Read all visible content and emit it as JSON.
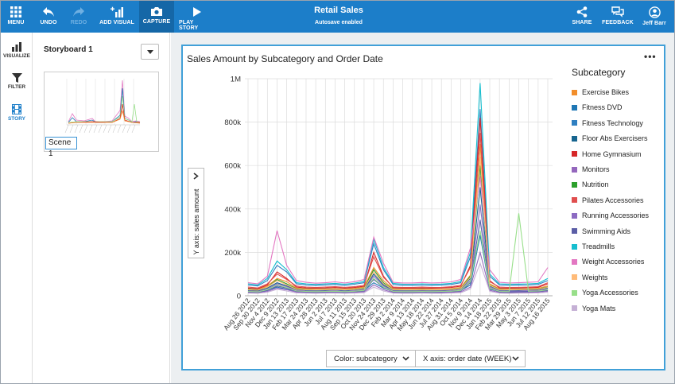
{
  "toolbar": {
    "menu": "MENU",
    "undo": "UNDO",
    "redo": "REDO",
    "add_visual": "ADD VISUAL",
    "capture": "CAPTURE",
    "play_story": "PLAY STORY",
    "title": "Retail Sales",
    "subtitle": "Autosave enabled",
    "share": "SHARE",
    "feedback": "FEEDBACK",
    "user": "Jeff Barr"
  },
  "rail": {
    "visualize": "VISUALIZE",
    "filter": "FILTER",
    "story": "STORY"
  },
  "storyboard": {
    "title": "Storyboard 1",
    "scene": "Scene 1"
  },
  "colors": {
    "topbar": "#1c7ec9",
    "accent": "#41a0d8"
  },
  "visual": {
    "title": "Sales Amount by Subcategory and Order Date",
    "more": "•••",
    "y_axis_field": "Y axis: sales amount",
    "color_field": "Color: subcategory",
    "x_axis_field": "X axis: order date (WEEK)"
  },
  "chart_data": {
    "type": "line",
    "title": "Sales Amount by Subcategory and Order Date",
    "ylabel": "sales amount",
    "xlabel": "order date (WEEK)",
    "ylim": [
      0,
      1000000
    ],
    "y_ticks": [
      "0",
      "200k",
      "400k",
      "600k",
      "800k",
      "1M"
    ],
    "y_tick_values": [
      0,
      200000,
      400000,
      600000,
      800000,
      1000000
    ],
    "x_ticks": [
      "Aug 26 2012",
      "Sep 30 2012",
      "Nov 4 2012",
      "Dec 9 2012",
      "Jan 13 2013",
      "Feb 17 2013",
      "Mar 24 2013",
      "Apr 28 2013",
      "Jun 2 2013",
      "Jul 7 2013",
      "Aug 11 2013",
      "Sep 15 2013",
      "Oct 20 2013",
      "Nov 24 2013",
      "Dec 29 2013",
      "Feb 2 2014",
      "Mar 9 2014",
      "Apr 13 2014",
      "May 18 2014",
      "Jun 22 2014",
      "Jul 27 2014",
      "Aug 31 2014",
      "Oct 5 2014",
      "Nov 9 2014",
      "Dec 14 2014",
      "Jan 18 2015",
      "Feb 22 2015",
      "Mar 29 2015",
      "May 3 2015",
      "Jun 7 2015",
      "Jul 12 2015",
      "Aug 16 2015"
    ],
    "x_tick_labels": [
      "Aug 26 2012",
      "Sep 30 2012",
      "Nov 4 2012",
      "Dec 9 2012",
      "Jan 13 2013",
      "Feb 17 2013",
      "Mar 24 2013",
      "Apr 28 2013",
      "Jun 2 2013",
      "Jul 7 2013",
      "Aug 11 2013",
      "Sep 15 2013",
      "Oct 20 2013",
      "Nov 24 2013",
      "Dec 29 2013",
      "Feb 2 2014",
      "Mar 9 2014",
      "Apr 13 2014",
      "May 18 2014",
      "Jun 22 2014",
      "Jul 27 2014",
      "Aug 31 2014",
      "Oct 5 2014",
      "Nov 9 2014",
      "Dec 14 2014",
      "Jan 18 2015",
      "Feb 22 2015",
      "Mar 29 2015",
      "May 3 2015",
      "Jun 7 2015",
      "Jul 12 2015",
      "Aug 16 2015"
    ],
    "grid": true,
    "legend_position": "right",
    "legend_title": "Subcategory",
    "series": [
      {
        "name": "Exercise Bikes",
        "color": "#f28e2b",
        "values": [
          30000,
          28000,
          45000,
          80000,
          65000,
          35000,
          32000,
          30000,
          31000,
          33000,
          30000,
          34000,
          40000,
          130000,
          70000,
          32000,
          30000,
          30000,
          31000,
          30000,
          30000,
          33000,
          38000,
          95000,
          700000,
          55000,
          32000,
          30000,
          31000,
          32000,
          34000,
          45000
        ]
      },
      {
        "name": "Fitness DVD",
        "color": "#1f77b4",
        "values": [
          20000,
          18000,
          25000,
          40000,
          30000,
          22000,
          20000,
          19000,
          20000,
          21000,
          20000,
          22000,
          24000,
          60000,
          35000,
          20000,
          19000,
          19000,
          20000,
          19000,
          20000,
          21000,
          24000,
          50000,
          280000,
          30000,
          20000,
          19000,
          20000,
          21000,
          22000,
          26000
        ]
      },
      {
        "name": "Fitness Technology",
        "color": "#2f7fc1",
        "values": [
          50000,
          45000,
          70000,
          140000,
          110000,
          55000,
          50000,
          48000,
          50000,
          52000,
          48000,
          53000,
          60000,
          240000,
          120000,
          52000,
          48000,
          48000,
          50000,
          48000,
          49000,
          52000,
          60000,
          180000,
          860000,
          90000,
          50000,
          48000,
          49000,
          50000,
          52000,
          70000
        ]
      },
      {
        "name": "Floor Abs Exercisers",
        "color": "#17658f",
        "values": [
          25000,
          23000,
          35000,
          60000,
          45000,
          28000,
          26000,
          25000,
          26000,
          27000,
          25000,
          27000,
          30000,
          100000,
          50000,
          26000,
          25000,
          25000,
          26000,
          25000,
          25000,
          27000,
          31000,
          80000,
          500000,
          45000,
          26000,
          25000,
          26000,
          27000,
          28000,
          35000
        ]
      },
      {
        "name": "Home Gymnasium",
        "color": "#d62728",
        "values": [
          35000,
          32000,
          50000,
          110000,
          80000,
          40000,
          36000,
          35000,
          36000,
          38000,
          35000,
          38000,
          44000,
          200000,
          90000,
          37000,
          35000,
          35000,
          36000,
          35000,
          36000,
          38000,
          44000,
          140000,
          820000,
          70000,
          36000,
          35000,
          36000,
          37000,
          39000,
          55000
        ]
      },
      {
        "name": "Monitors",
        "color": "#9467bd",
        "values": [
          15000,
          14000,
          20000,
          35000,
          28000,
          17000,
          15000,
          15000,
          15000,
          16000,
          15000,
          16000,
          18000,
          50000,
          28000,
          15000,
          15000,
          15000,
          15000,
          15000,
          15000,
          16000,
          18000,
          40000,
          200000,
          25000,
          15000,
          15000,
          15000,
          16000,
          17000,
          20000
        ]
      },
      {
        "name": "Nutrition",
        "color": "#2ca02c",
        "values": [
          30000,
          27000,
          40000,
          75000,
          55000,
          32000,
          29000,
          28000,
          29000,
          30000,
          28000,
          30000,
          35000,
          120000,
          60000,
          29000,
          28000,
          28000,
          29000,
          28000,
          28000,
          30000,
          34000,
          90000,
          600000,
          50000,
          29000,
          28000,
          29000,
          30000,
          31000,
          40000
        ]
      },
      {
        "name": "Pilates Accessories",
        "color": "#e04e4e",
        "values": [
          40000,
          36000,
          55000,
          100000,
          75000,
          45000,
          40000,
          38000,
          40000,
          42000,
          39000,
          42000,
          48000,
          180000,
          85000,
          40000,
          38000,
          38000,
          40000,
          38000,
          39000,
          42000,
          48000,
          130000,
          750000,
          65000,
          40000,
          38000,
          39000,
          40000,
          42000,
          60000
        ]
      },
      {
        "name": "Running Accessories",
        "color": "#8c6bc2",
        "values": [
          22000,
          20000,
          30000,
          55000,
          42000,
          25000,
          22000,
          21000,
          22000,
          23000,
          21000,
          23000,
          27000,
          90000,
          45000,
          22000,
          21000,
          21000,
          22000,
          21000,
          22000,
          23000,
          27000,
          70000,
          420000,
          40000,
          22000,
          21000,
          22000,
          23000,
          24000,
          30000
        ]
      },
      {
        "name": "Swimming Aids",
        "color": "#5b5ea6",
        "values": [
          18000,
          16000,
          24000,
          45000,
          35000,
          20000,
          18000,
          17000,
          18000,
          19000,
          17000,
          19000,
          22000,
          75000,
          38000,
          18000,
          17000,
          17000,
          18000,
          17000,
          18000,
          19000,
          22000,
          60000,
          350000,
          33000,
          18000,
          17000,
          18000,
          19000,
          20000,
          24000
        ]
      },
      {
        "name": "Treadmills",
        "color": "#17becf",
        "values": [
          55000,
          50000,
          80000,
          160000,
          120000,
          60000,
          55000,
          52000,
          55000,
          57000,
          53000,
          58000,
          66000,
          260000,
          130000,
          57000,
          53000,
          53000,
          55000,
          53000,
          54000,
          57000,
          66000,
          200000,
          980000,
          100000,
          55000,
          53000,
          54000,
          55000,
          57000,
          80000
        ]
      },
      {
        "name": "Weight Accessories",
        "color": "#e377c2",
        "values": [
          60000,
          55000,
          90000,
          300000,
          140000,
          70000,
          62000,
          58000,
          60000,
          64000,
          59000,
          65000,
          75000,
          270000,
          150000,
          62000,
          59000,
          59000,
          61000,
          59000,
          60000,
          64000,
          75000,
          220000,
          550000,
          120000,
          62000,
          59000,
          60000,
          62000,
          64000,
          130000
        ]
      },
      {
        "name": "Weights",
        "color": "#ffbb78",
        "values": [
          28000,
          26000,
          40000,
          70000,
          50000,
          30000,
          28000,
          27000,
          28000,
          29000,
          27000,
          29000,
          33000,
          110000,
          55000,
          28000,
          27000,
          27000,
          28000,
          27000,
          27000,
          29000,
          33000,
          85000,
          640000,
          48000,
          28000,
          27000,
          28000,
          29000,
          30000,
          38000
        ]
      },
      {
        "name": "Yoga Accessories",
        "color": "#98df8a",
        "values": [
          20000,
          18000,
          28000,
          50000,
          38000,
          22000,
          20000,
          19000,
          20000,
          21000,
          19000,
          21000,
          25000,
          80000,
          40000,
          20000,
          19000,
          19000,
          20000,
          19000,
          20000,
          21000,
          25000,
          65000,
          300000,
          35000,
          20000,
          19000,
          380000,
          21000,
          22000,
          28000
        ]
      },
      {
        "name": "Yoga Mats",
        "color": "#c5b0d5",
        "values": [
          12000,
          11000,
          16000,
          30000,
          22000,
          13000,
          12000,
          11000,
          12000,
          12000,
          11000,
          12000,
          14000,
          40000,
          22000,
          12000,
          11000,
          11000,
          12000,
          11000,
          11000,
          12000,
          14000,
          32000,
          150000,
          20000,
          12000,
          11000,
          12000,
          12000,
          13000,
          16000
        ]
      }
    ]
  }
}
